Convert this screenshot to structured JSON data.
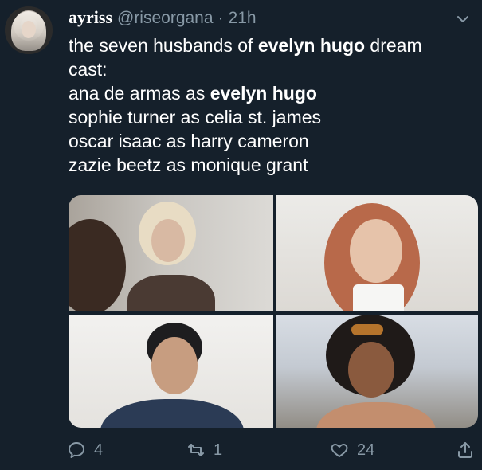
{
  "tweet": {
    "author_name": "ayriss",
    "handle": "@riseorgana",
    "separator": "·",
    "time": "21h",
    "text": {
      "line1_pre": "the seven husbands of ",
      "line1_bold": "evelyn hugo",
      "line1_post": " dream",
      "line2": "cast:",
      "line3_pre": "ana de armas as ",
      "line3_bold": "evelyn hugo",
      "line4": "sophie turner as celia st. james",
      "line5": "oscar isaac as harry cameron",
      "line6": "zazie beetz as monique grant"
    }
  },
  "actions": {
    "reply_count": "4",
    "retweet_count": "1",
    "like_count": "24"
  },
  "icons": {
    "reply": "reply-icon",
    "retweet": "retweet-icon",
    "like": "heart-icon",
    "share": "share-icon",
    "menu": "chevron-down-icon"
  },
  "colors": {
    "background": "#15202b",
    "secondary_text": "#8899a6",
    "primary_text": "#ffffff"
  }
}
